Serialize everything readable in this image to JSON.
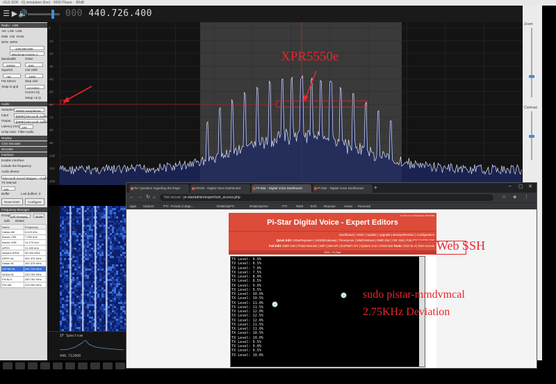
{
  "sdr": {
    "window_title": "rGUI SDR · IQ simulation (live) · 0000 Phase · -80dB",
    "frequency_display": "000 440.726.400",
    "frequency_dim": "000",
    "frequency_main": "440.726.400",
    "zoom_label": "Zoom",
    "contrast_label": "Contrast",
    "left_panel": {
      "section_radio": "Radio · LSB",
      "modes": [
        "AM",
        "LSB",
        "USB",
        "DSB",
        "CW",
        "RAW",
        "NFM",
        "WFM"
      ],
      "shift": "-100,000,000",
      "filter": "Blackman-Harris 4",
      "bandwidth_label": "Bandwidth",
      "order_label": "Order",
      "bandwidth_value": "20000",
      "order_value": "500",
      "squelch_label": "Squelch",
      "cw_shift_label": "CW Shift",
      "squelch_value": "-50",
      "cw_shift_value": "1000",
      "fm_stereo": "FM Stereo",
      "step_size_label": "Step size",
      "snap_label": "Snap to grid",
      "snap_value": "12.5 kHz",
      "correct_iq": "Correct IQ",
      "swap_iq": "Swap I & Q",
      "section_audio": "Audio",
      "samplerate_label": "Samplerate",
      "samplerate_value": "48000 sample/sec",
      "input_label": "Input",
      "input_value": "[MME] Microsoft Sound",
      "output_label": "Output",
      "output_value": "[MME] Microsoft Sound",
      "latency_label": "Latency (ms)",
      "latency_value": "100",
      "unity_gain": "Unity Gain",
      "filter_audio": "Filter Audio",
      "section_display": "Display",
      "section_css": "CSS Decoder",
      "section_decoder": "Decoder",
      "section_interface": "Interface",
      "enable_interface": "Enable Interface",
      "include_freq": "Include the frequency",
      "audio_device_label": "Audio device",
      "audio_device_value": "Microsoft Sound Mapper - Output",
      "tx_interval_label": "TX interval",
      "tx_interval_value": "100",
      "buffer_label": "Buffer",
      "lost_buffers": "Lost buffers: 0",
      "reset_dsd": "Reset DSD",
      "configure": "Configure",
      "section_freq_manager": "Frequency Manager",
      "group_label": "Group",
      "group_value": "[All Groups]",
      "scan_btn": "Scan",
      "edit_btn": "Edit",
      "delete_btn": "Delete",
      "table_headers": [
        "Name",
        "Frequency"
      ],
      "table_rows": [
        [
          "Dallas AM",
          "8.425 kHz"
        ],
        [
          "Bands LSB",
          "7.050 kHz"
        ],
        [
          "Bands USB",
          "14.270 kHz"
        ],
        [
          "APRS",
          "21.400 kHz"
        ],
        [
          "Airband WFM",
          "90.000 MHz"
        ],
        [
          "APRS NL",
          "392.375 MHz"
        ],
        [
          "Dallas NL",
          "304.375 MHz"
        ],
        [
          "DSTAR NL",
          "440.726 MHz"
        ],
        [
          "NOAA NL",
          "433.750 MHz"
        ],
        [
          "FM BLS",
          "439.750 MHz"
        ],
        [
          "ISS AM",
          "478.250 MHz"
        ]
      ],
      "selected_row": 7
    },
    "spectrum": {
      "db_ticks": [
        "0",
        "-10",
        "-20",
        "-30",
        "-40",
        "-50",
        "-60",
        "-70",
        "-80",
        "-90",
        "-100",
        "-110",
        "-120"
      ],
      "freq_ticks": [
        "440.700",
        "440.710",
        "440.720",
        "440.730",
        "440.740",
        "440.750"
      ]
    },
    "bottom_strip": {
      "label": "IF Spectrum",
      "freq": "440.712000"
    }
  },
  "annotations": {
    "xpr_label": "XPR5550e",
    "web_ssh_a": "Web",
    "web_ssh_b": "SSH",
    "cmd_line1": "sudo pistar-mmdvmcal",
    "cmd_line2": "2.75KHz Deviation",
    "accent_color": "#e8262e"
  },
  "browser": {
    "tabs": [
      "Re: Question regarding the Repe",
      "KR1NI - Digital Voice Dashboard",
      "Pi-Star - Digital Voice Dashboard",
      "Pi-Star - Digital Voice Dashboard"
    ],
    "active_tab": 2,
    "url_not_secure": "Not secure",
    "url": "pi-star/admin/expert/ssh_access.php",
    "bookmarks": [
      "Apps",
      "Clarium",
      "PTI - Portals (Adapt...",
      "RelativityPTI",
      "RelativityOne",
      "PTI",
      "NWS",
      "Tech",
      "Reunion",
      "Home",
      "Personal"
    ],
    "pistar": {
      "version": "Pi-Star:4.1.4 / Dashboard: 20210409",
      "title": "Pi-Star Digital Voice - Expert Editors",
      "nav_main": "Dashboard | Admin | Update | Upgrade | Backup/Restore | Configuration",
      "nav_quick_label": "Quick Edit:",
      "nav_quick": "DStarRepeater | ircDDBGateway | TimeServer | MMDVMHost | DMR GW | YSF GW | P25 GW | NXDN GW",
      "nav_full_label": "Full Edit:",
      "nav_full": "DMR GW | PiStar-Remote | WiFi | BM API | DAPNET API | System Cron | RSSI Dat",
      "nav_tools_label": "Tools:",
      "nav_tools": "CSS Tool | SSH Access",
      "section_bar": "SSH - Pi-Star",
      "terminal_lines": [
        "TX Level: 0.0%",
        "TX Level: 6.5%",
        "TX Level: 7.0%",
        "TX Level: 7.5%",
        "TX Level: 8.0%",
        "TX Level: 8.5%",
        "TX Level: 9.0%",
        "TX Level: 9.5%",
        "TX Level: 10.0%",
        "TX Level: 10.5%",
        "TX Level: 11.0%",
        "TX Level: 11.5%",
        "TX Level: 12.0%",
        "TX Level: 12.5%",
        "TX Level: 12.0%",
        "TX Level: 11.5%",
        "TX Level: 11.0%",
        "TX Level: 10.5%",
        "TX Level: 10.0%",
        "TX Level: 9.5%",
        "TX Level: 9.0%",
        "TX Level: 9.5%",
        "TX Level: 10.0%"
      ]
    }
  },
  "cursor_markers": [
    "1",
    "3"
  ]
}
